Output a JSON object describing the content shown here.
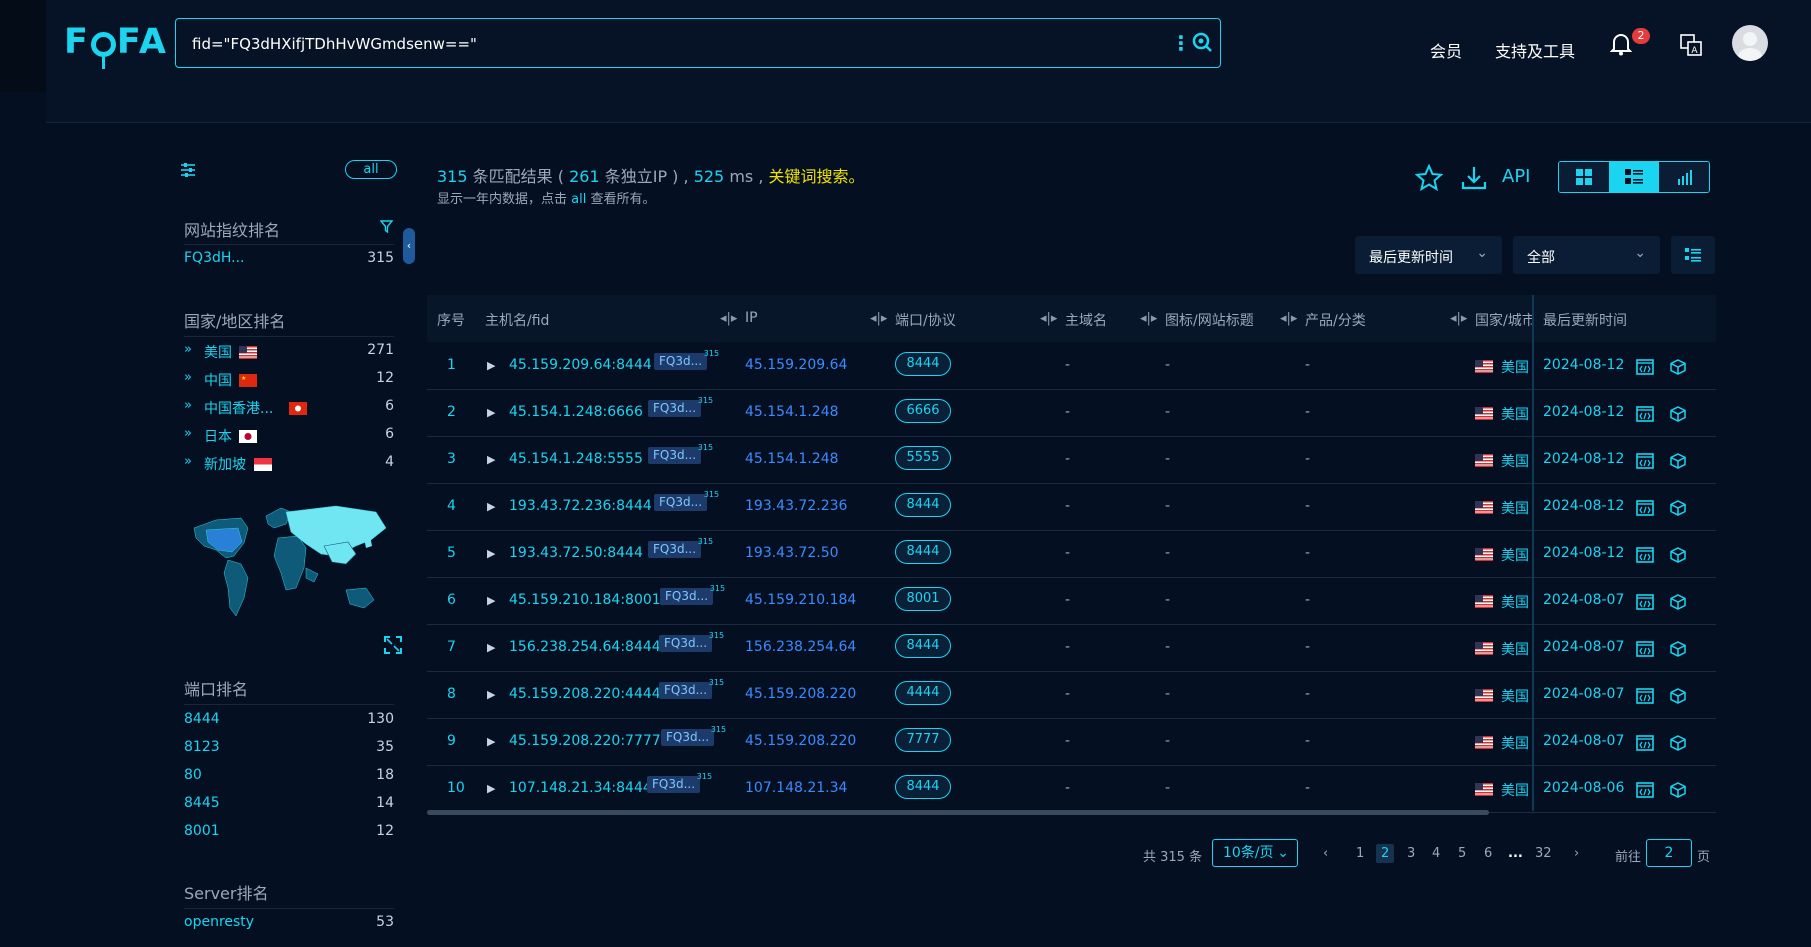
{
  "header": {
    "logo": "FOFA",
    "search_value": "fid=\"FQ3dHXifjTDhHvWGmdsenw==\"",
    "nav": [
      "会员",
      "支持及工具"
    ],
    "notification_count": "2"
  },
  "sidebar": {
    "all_label": "all",
    "fingerprint": {
      "title": "网站指纹排名",
      "items": [
        {
          "label": "FQ3dH...",
          "count": "315"
        }
      ]
    },
    "country": {
      "title": "国家/地区排名",
      "items": [
        {
          "label": "美国",
          "count": "271"
        },
        {
          "label": "中国",
          "count": "12"
        },
        {
          "label": "中国香港...",
          "count": "6"
        },
        {
          "label": "日本",
          "count": "6"
        },
        {
          "label": "新加坡",
          "count": "4"
        }
      ]
    },
    "port": {
      "title": "端口排名",
      "items": [
        {
          "label": "8444",
          "count": "130"
        },
        {
          "label": "8123",
          "count": "35"
        },
        {
          "label": "80",
          "count": "18"
        },
        {
          "label": "8445",
          "count": "14"
        },
        {
          "label": "8001",
          "count": "12"
        }
      ]
    },
    "server": {
      "title": "Server排名",
      "items": [
        {
          "label": "openresty",
          "count": "53"
        }
      ]
    }
  },
  "summary": {
    "total": "315",
    "t1": "条匹配结果 (",
    "unique_ip": "261",
    "t2": "条独立IP ) ,",
    "ms": "525",
    "t3": "ms ,",
    "keyword": "关键词搜索。",
    "note_pre": "显示一年内数据，点击",
    "note_all": "all",
    "note_post": "查看所有。",
    "api": "API"
  },
  "filters": {
    "sort": "最后更新时间",
    "scope": "全部"
  },
  "table": {
    "headers": {
      "idx": "序号",
      "host": "主机名/fid",
      "ip": "IP",
      "port": "端口/协议",
      "domain": "主域名",
      "title": "图标/网站标题",
      "product": "产品/分类",
      "country": "国家/城市",
      "date": "最后更新时间"
    },
    "fid_badge": "FQ3d...",
    "fid_count": "315",
    "rows": [
      {
        "idx": "1",
        "host": "45.159.209.64:8444",
        "ip": "45.159.209.64",
        "port": "8444",
        "domain": "-",
        "title": "-",
        "product": "-",
        "country": "美国",
        "date": "2024-08-12"
      },
      {
        "idx": "2",
        "host": "45.154.1.248:6666",
        "ip": "45.154.1.248",
        "port": "6666",
        "domain": "-",
        "title": "-",
        "product": "-",
        "country": "美国",
        "date": "2024-08-12"
      },
      {
        "idx": "3",
        "host": "45.154.1.248:5555",
        "ip": "45.154.1.248",
        "port": "5555",
        "domain": "-",
        "title": "-",
        "product": "-",
        "country": "美国",
        "date": "2024-08-12"
      },
      {
        "idx": "4",
        "host": "193.43.72.236:8444",
        "ip": "193.43.72.236",
        "port": "8444",
        "domain": "-",
        "title": "-",
        "product": "-",
        "country": "美国",
        "date": "2024-08-12"
      },
      {
        "idx": "5",
        "host": "193.43.72.50:8444",
        "ip": "193.43.72.50",
        "port": "8444",
        "domain": "-",
        "title": "-",
        "product": "-",
        "country": "美国",
        "date": "2024-08-12"
      },
      {
        "idx": "6",
        "host": "45.159.210.184:8001",
        "ip": "45.159.210.184",
        "port": "8001",
        "domain": "-",
        "title": "-",
        "product": "-",
        "country": "美国",
        "date": "2024-08-07"
      },
      {
        "idx": "7",
        "host": "156.238.254.64:8444",
        "ip": "156.238.254.64",
        "port": "8444",
        "domain": "-",
        "title": "-",
        "product": "-",
        "country": "美国",
        "date": "2024-08-07"
      },
      {
        "idx": "8",
        "host": "45.159.208.220:4444",
        "ip": "45.159.208.220",
        "port": "4444",
        "domain": "-",
        "title": "-",
        "product": "-",
        "country": "美国",
        "date": "2024-08-07"
      },
      {
        "idx": "9",
        "host": "45.159.208.220:7777",
        "ip": "45.159.208.220",
        "port": "7777",
        "domain": "-",
        "title": "-",
        "product": "-",
        "country": "美国",
        "date": "2024-08-07"
      },
      {
        "idx": "10",
        "host": "107.148.21.34:8444",
        "ip": "107.148.21.34",
        "port": "8444",
        "domain": "-",
        "title": "-",
        "product": "-",
        "country": "美国",
        "date": "2024-08-06"
      }
    ]
  },
  "pagination": {
    "total_text": "共 315 条",
    "page_size": "10条/页",
    "pages": [
      "1",
      "2",
      "3",
      "4",
      "5",
      "6"
    ],
    "ellipsis": "...",
    "last": "32",
    "current": "2",
    "goto_label": "前往",
    "goto_value": "2",
    "goto_suffix": "页"
  },
  "colors": {
    "accent": "#1ad4f0",
    "link_blue": "#3a8bff",
    "keyword": "#f2e200",
    "background": "#041022"
  }
}
